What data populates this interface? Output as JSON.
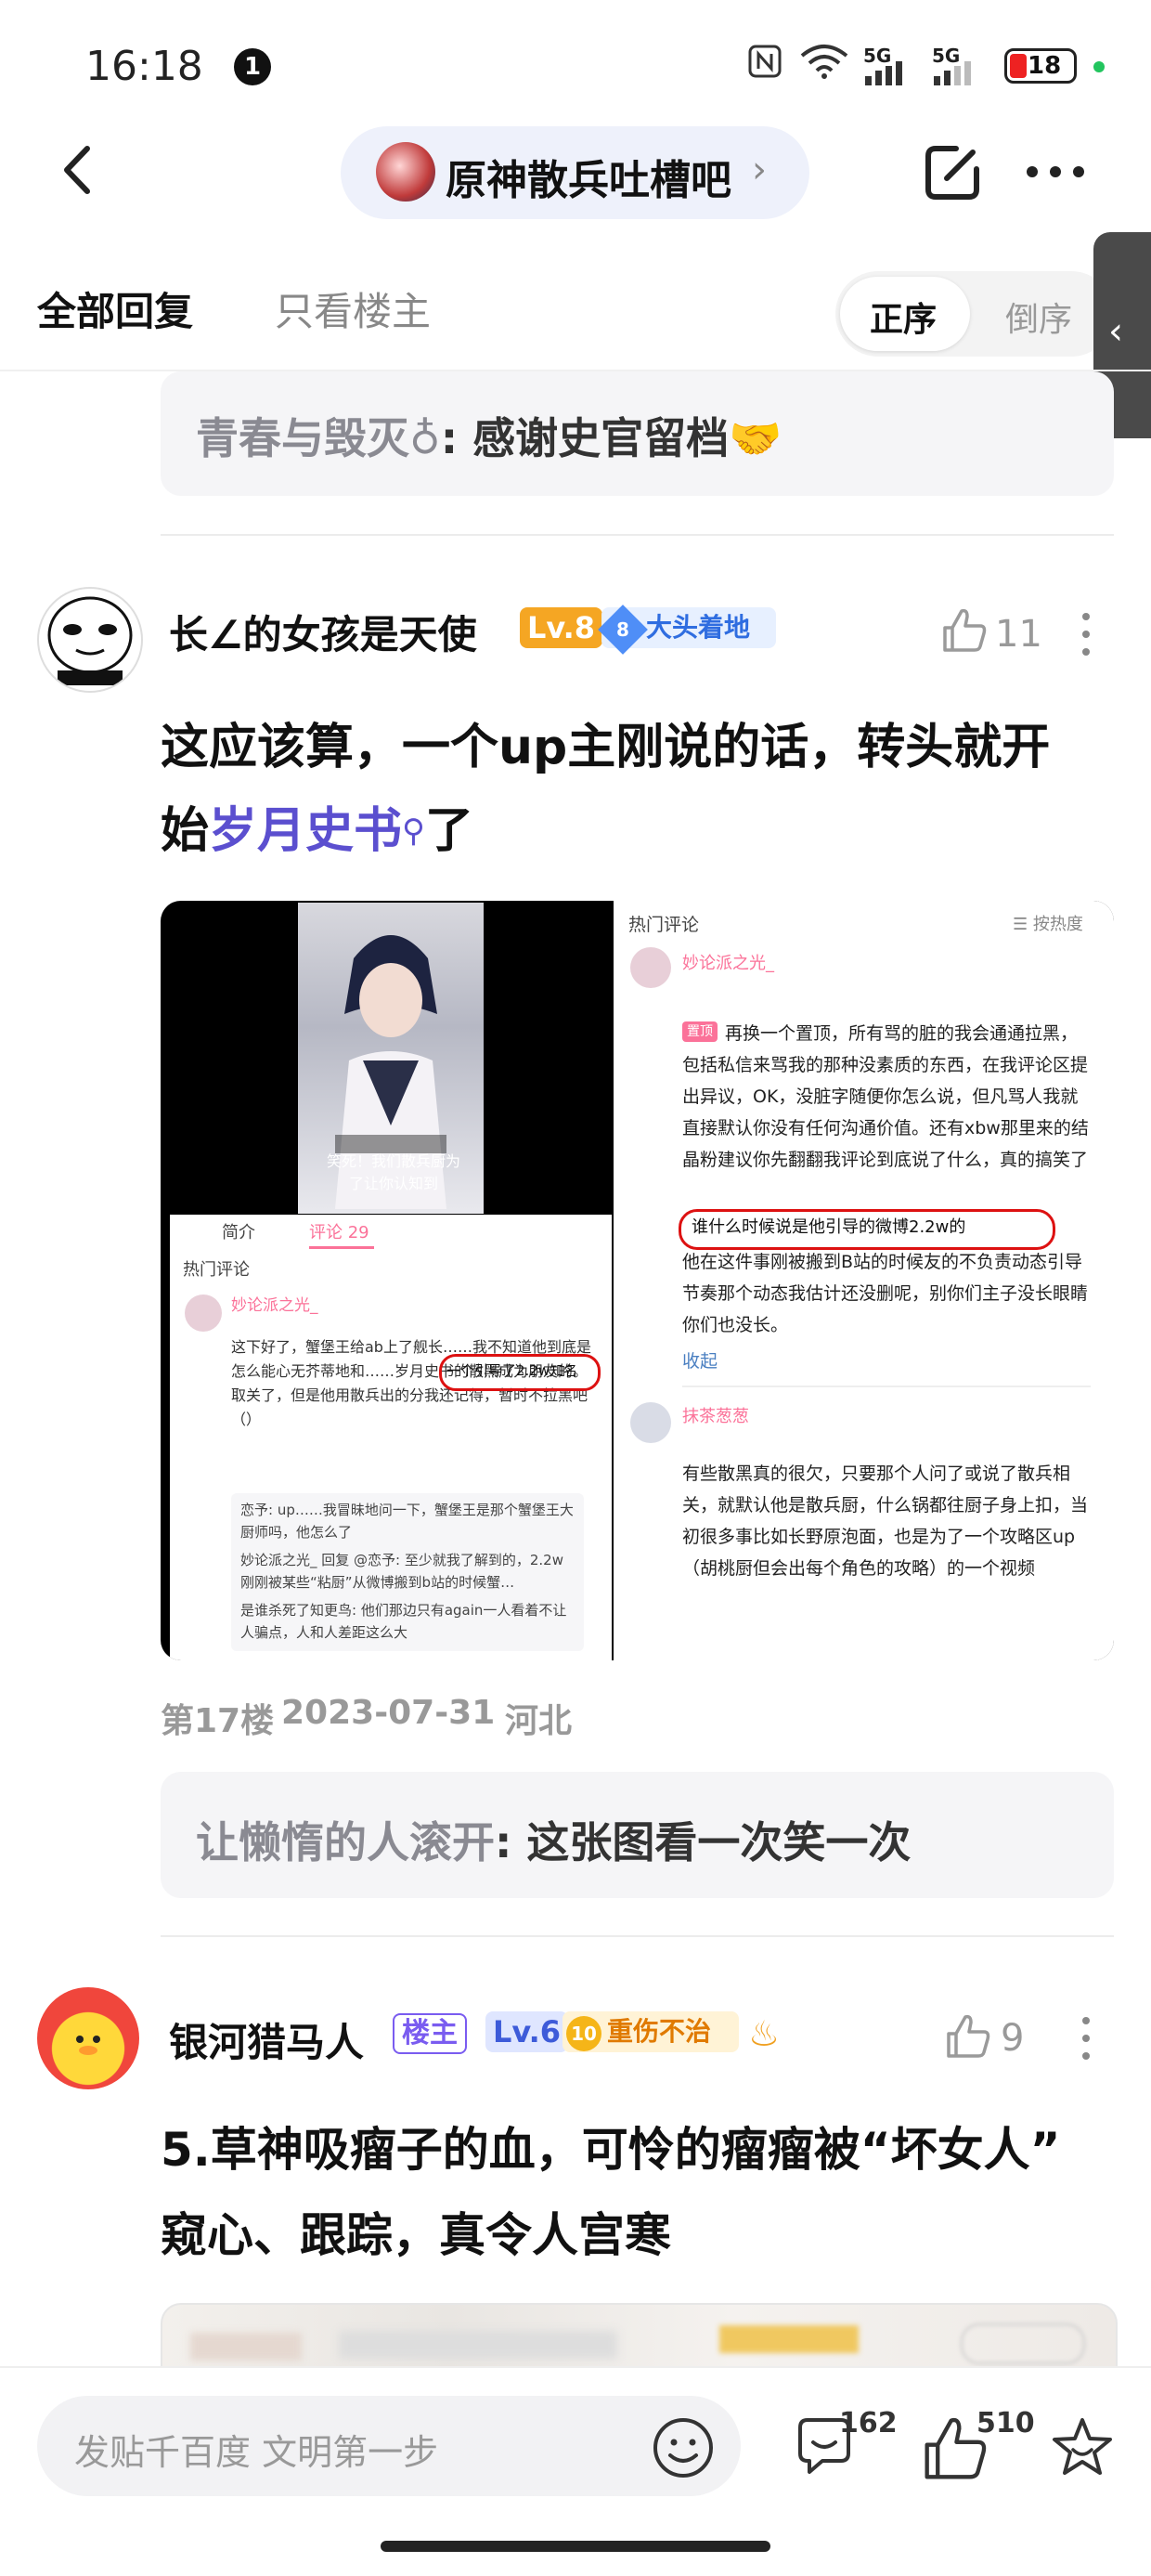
{
  "status_bar": {
    "time": "16:18",
    "notification_badge": "1",
    "signal_1": "5G",
    "signal_2": "5G",
    "battery": "18"
  },
  "nav": {
    "forum_name": "原神散兵吐槽吧",
    "chevron": "›"
  },
  "tabs": {
    "all": "全部回复",
    "op_only": "只看楼主",
    "order_asc": "正序",
    "order_desc": "倒序"
  },
  "quote_top": {
    "user": "青春与毁灭♁",
    "text": ": 感谢史官留档",
    "emoji": "🤝"
  },
  "post1": {
    "username": "长∠的女孩是天使",
    "level": "Lv.8",
    "badge_num": "8",
    "badge_text": "大头着地",
    "likes": "11",
    "text_1": "这应该算，一个up主刚说的话，转头就开",
    "text_2_pre": "始",
    "text_2_link": "岁月史书",
    "text_2_post": "了",
    "floor": "第17楼",
    "date": "2023-07-31",
    "location": "河北"
  },
  "image": {
    "hot_comments": "热门评论",
    "sort_hot": "☰ 按热度",
    "commenter_1": "妙论派之光_",
    "reply_tag": "置顶",
    "comment_1": "再换一个置顶，所有骂的脏的我会通通拉黑，包括私信来骂我的那种没素质的东西，在我评论区提出异议，OK，没脏字随便你怎么说，但凡骂人我就直接默认你没有任何沟通价值。还有xbw那里来的结晶粉建议你先翻翻我评论到底说了什么，真的搞笑了",
    "highlight_1": "谁什么时候说是他引导的微博2.2w的",
    "comment_1_tail": "他在这件事刚被搬到B站的时候友的不负责动态引导节奏那个动态我估计还没删呢，别你们主子没长眼睛你们也没长。",
    "collapse": "收起",
    "commenter_2": "抹茶葱葱",
    "comment_2": "有些散黑真的很欠，只要那个人问了或说了散兵相关，就默认他是散兵厨，什么锅都往厨子身上扣，当初很多事比如长野原泡面，也是为了一个攻略区up（胡桃厨但会出每个角色的攻略）的一个视频",
    "left_tab_intro": "简介",
    "left_tab_comments": "评论 29",
    "left_hot": "热门评论",
    "left_comment": "这下好了，蟹堡王给ab上了舰长……我不知道他到底是怎么能心无芥蒂地和……岁月史书的散黑成为朋友的。取关了，但是他用散兵出的分我还记得，暂时不拉黑吧（）",
    "left_highlight": "一个引导了2.2w知名",
    "left_reply_1": "恋予: up……我冒昧地问一下，蟹堡王是那个蟹堡王大厨师吗，他怎么了",
    "left_reply_2": "妙论派之光_ 回复 @恋予: 至少就我了解到的，2.2w刚刚被某些“粘厨”从微博搬到b站的时候蟹…",
    "left_reply_3": "是谁杀死了知更鸟: 他们那边只有again一人看着不让人骗点，人和人差距这么大",
    "video_caption": "笑死！我们散兵厨为了让你认知到"
  },
  "quote_mid": {
    "user": "让懒惰的人滚开",
    "text": ": 这张图看一次笑一次"
  },
  "post2": {
    "username": "银河猎马人",
    "op_tag": "楼主",
    "level": "Lv.6",
    "badge_num": "10",
    "badge_text": "重伤不治",
    "likes": "9",
    "text_1": "5.草神吸瘤子的血，可怜的瘤瘤被“坏女人”",
    "text_2": "窥心、跟踪，真令人宫寒"
  },
  "bottom": {
    "placeholder": "发贴千百度 文明第一步",
    "comments_count": "162",
    "likes_count": "510"
  },
  "colors": {
    "accent_link": "#5b4fcf",
    "badge_blue": "#3b82f6",
    "level_orange": "#f5a623",
    "op_purple": "#7a5cf0",
    "highlight_red": "#d11"
  }
}
